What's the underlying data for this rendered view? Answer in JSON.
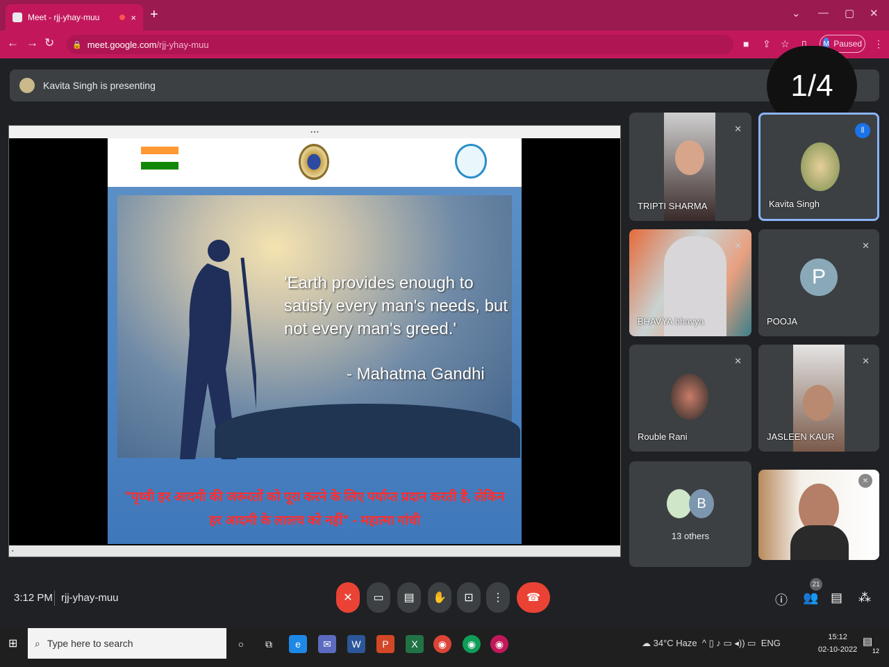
{
  "browser": {
    "tab_title": "Meet - rjj-yhay-muu",
    "tab_close": "×",
    "new_tab": "+",
    "url_host": "meet.google.com",
    "url_path": "/rjj-yhay-muu",
    "profile_letter": "M",
    "profile_status": "Paused"
  },
  "meet": {
    "presenting_text": "Kavita Singh is presenting",
    "page_counter": "1/4",
    "time": "3:12 PM",
    "meeting_code": "rjj-yhay-muu",
    "participant_count": "21",
    "others_label": "13 others",
    "others_letter": "B"
  },
  "slide": {
    "quote": "'Earth provides enough to satisfy every man's needs, but not every man's greed.'",
    "author": "- Mahatma Gandhi",
    "hindi": "\"पृथ्वी हर आदमी की जरूरतों को पूरा करने के लिए पर्याप्त प्रदान करती है, लेकिन हर आदमी के लालच को नहीं\" - महात्मा गांधी"
  },
  "participants": [
    {
      "name": "TRIPTI SHARMA"
    },
    {
      "name": "Kavita Singh"
    },
    {
      "name": "BHAVYA bhavya"
    },
    {
      "name": "POOJA",
      "letter": "P"
    },
    {
      "name": "Rouble Rani"
    },
    {
      "name": "JASLEEN KAUR"
    }
  ],
  "taskbar": {
    "search_placeholder": "Type here to search",
    "weather": "34°C  Haze",
    "lang": "ENG",
    "time": "15:12",
    "date": "02-10-2022",
    "notif_count": "12"
  },
  "colors": {
    "browser_accent": "#c2185b",
    "end_call": "#ea4335",
    "active_speaker": "#8ab4f8",
    "hindi_text": "#ff2d2d"
  }
}
